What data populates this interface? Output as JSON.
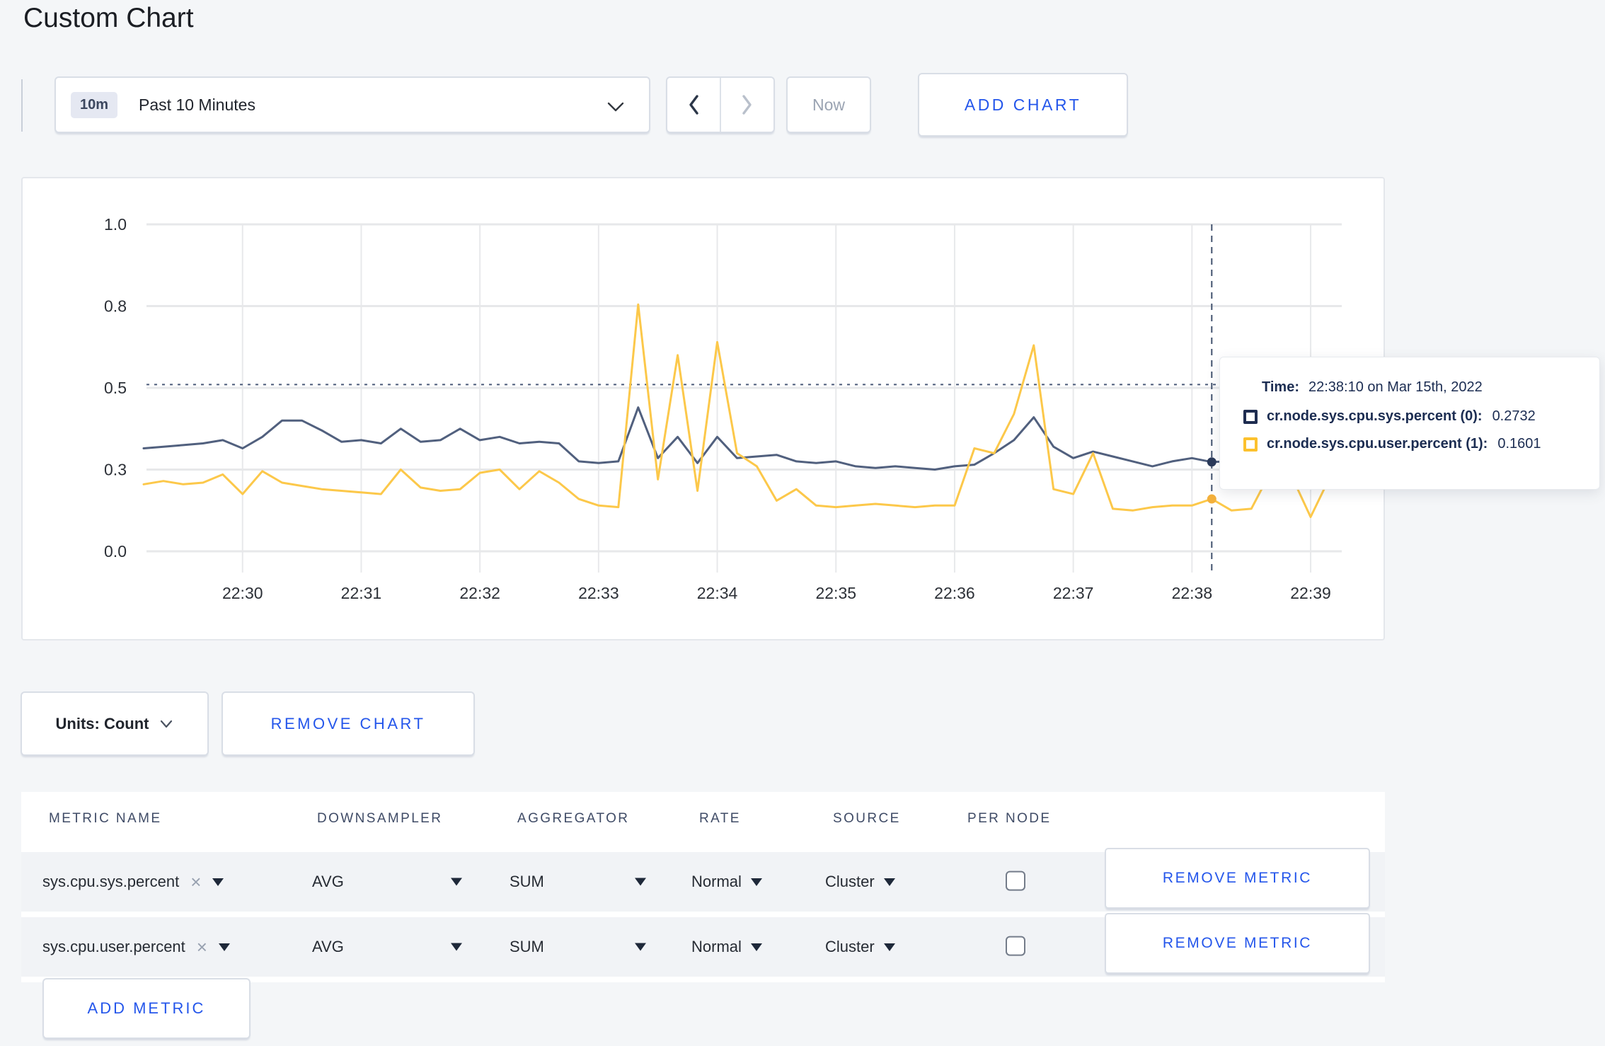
{
  "page": {
    "title": "Custom Chart",
    "background": "#f4f6f8",
    "accent_blue": "#2456eb"
  },
  "toolbar": {
    "time_badge": "10m",
    "time_label": "Past 10 Minutes",
    "prev_label": "previous time window",
    "next_label": "next time window",
    "now_label": "Now",
    "add_chart_label": "ADD CHART"
  },
  "tooltip": {
    "time_label": "Time:",
    "time_value": "22:38:10 on Mar 15th, 2022",
    "series": [
      {
        "name": "cr.node.sys.cpu.sys.percent (0):",
        "value": "0.2732",
        "swatch": "#1e2c50"
      },
      {
        "name": "cr.node.sys.cpu.user.percent (1):",
        "value": "0.1601",
        "swatch": "#fcc12e"
      }
    ]
  },
  "units": {
    "label": "Units: Count",
    "remove_chart_label": "REMOVE CHART"
  },
  "table": {
    "headers": [
      "METRIC NAME",
      "DOWNSAMPLER",
      "AGGREGATOR",
      "RATE",
      "SOURCE",
      "PER NODE"
    ],
    "rows": [
      {
        "metric": "sys.cpu.sys.percent",
        "downsampler": "AVG",
        "aggregator": "SUM",
        "rate": "Normal",
        "source": "Cluster",
        "per_node_checked": false,
        "remove_label": "REMOVE METRIC"
      },
      {
        "metric": "sys.cpu.user.percent",
        "downsampler": "AVG",
        "aggregator": "SUM",
        "rate": "Normal",
        "source": "Cluster",
        "per_node_checked": false,
        "remove_label": "REMOVE METRIC"
      }
    ],
    "add_metric_label": "ADD METRIC"
  },
  "icons": {
    "clear_x": "×"
  },
  "chart_data": {
    "type": "line",
    "title": "",
    "xlabel": "",
    "ylabel": "",
    "ylim": [
      0,
      1
    ],
    "grid": true,
    "legend_position": "tooltip-only",
    "x_start": "22:29:10",
    "x_step_seconds": 10,
    "x_ticks": [
      "22:30",
      "22:31",
      "22:32",
      "22:33",
      "22:34",
      "22:35",
      "22:36",
      "22:37",
      "22:38",
      "22:39"
    ],
    "y_ticks": {
      "labels": [
        "0.0",
        "0.3",
        "0.5",
        "0.8",
        "1.0"
      ],
      "values": [
        0,
        0.25,
        0.5,
        0.75,
        1.0
      ]
    },
    "series": [
      {
        "name": "cr.node.sys.cpu.sys.percent",
        "color": "#51607e",
        "values": [
          0.315,
          0.32,
          0.325,
          0.33,
          0.34,
          0.315,
          0.35,
          0.4,
          0.4,
          0.37,
          0.335,
          0.34,
          0.33,
          0.375,
          0.335,
          0.34,
          0.375,
          0.34,
          0.35,
          0.33,
          0.335,
          0.33,
          0.275,
          0.27,
          0.275,
          0.44,
          0.285,
          0.35,
          0.27,
          0.35,
          0.285,
          0.29,
          0.295,
          0.275,
          0.27,
          0.275,
          0.26,
          0.255,
          0.26,
          0.255,
          0.25,
          0.26,
          0.265,
          0.3,
          0.34,
          0.41,
          0.32,
          0.285,
          0.305,
          0.29,
          0.275,
          0.26,
          0.275,
          0.285,
          0.2732,
          0.275,
          0.285,
          0.275,
          0.27,
          0.275,
          0.28
        ]
      },
      {
        "name": "cr.node.sys.cpu.user.percent",
        "color": "#fcc84a",
        "values": [
          0.205,
          0.215,
          0.205,
          0.21,
          0.235,
          0.175,
          0.245,
          0.21,
          0.2,
          0.19,
          0.185,
          0.18,
          0.175,
          0.25,
          0.195,
          0.185,
          0.19,
          0.24,
          0.25,
          0.19,
          0.245,
          0.21,
          0.16,
          0.14,
          0.135,
          0.755,
          0.22,
          0.6,
          0.185,
          0.64,
          0.3,
          0.26,
          0.155,
          0.19,
          0.14,
          0.135,
          0.14,
          0.145,
          0.14,
          0.135,
          0.14,
          0.14,
          0.315,
          0.3,
          0.42,
          0.63,
          0.19,
          0.175,
          0.3,
          0.13,
          0.125,
          0.135,
          0.14,
          0.14,
          0.1601,
          0.125,
          0.13,
          0.245,
          0.235,
          0.105,
          0.23
        ]
      }
    ],
    "hover": {
      "index": 54,
      "time": "22:38:10",
      "guide_y": 0.51,
      "dot_colors": [
        "#2b3a5a",
        "#f3b03c"
      ]
    }
  }
}
